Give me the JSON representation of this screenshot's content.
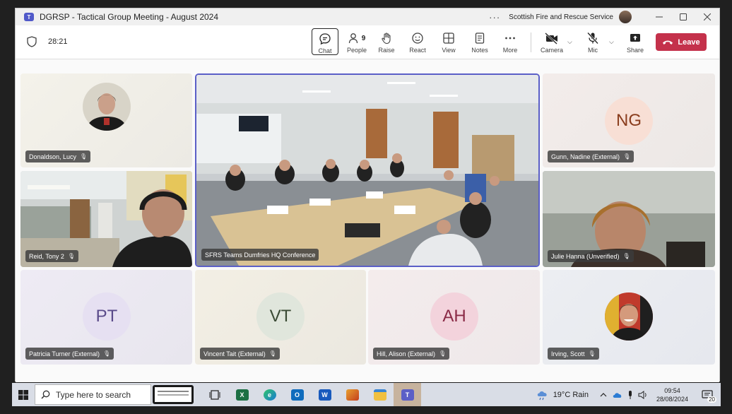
{
  "window": {
    "title": "DGRSP - Tactical Group Meeting - August 2024",
    "organization": "Scottish Fire and Rescue Service",
    "more_dots": "···"
  },
  "toolbar": {
    "timer": "28:21",
    "buttons": {
      "chat": "Chat",
      "people": "People",
      "people_count": "9",
      "raise": "Raise",
      "react": "React",
      "view": "View",
      "notes": "Notes",
      "more": "More",
      "camera": "Camera",
      "mic": "Mic",
      "share": "Share"
    },
    "leave": "Leave"
  },
  "participants": {
    "donaldson": {
      "name": "Donaldson, Lucy"
    },
    "reid": {
      "name": "Reid, Tony 2"
    },
    "conference": {
      "name": "SFRS Teams Dumfries HQ Conference"
    },
    "gunn": {
      "name": "Gunn, Nadine (External)",
      "initials": "NG"
    },
    "hanna": {
      "name": "Julie Hanna (Unverified)"
    },
    "turner": {
      "name": "Patricia Turner (External)",
      "initials": "PT"
    },
    "tait": {
      "name": "Vincent Tait (External)",
      "initials": "VT"
    },
    "hill": {
      "name": "Hill, Alison (External)",
      "initials": "AH"
    },
    "irving": {
      "name": "Irving, Scott"
    }
  },
  "colors": {
    "accent": "#5b5fc7",
    "leave": "#c4314b",
    "pt_bg": "#e6e0f2",
    "vt_bg": "#e0e6dc",
    "ah_bg": "#f3d3dc",
    "ng_bg": "#f8dfd5"
  },
  "taskbar": {
    "search_placeholder": "Type here to search",
    "weather": "19°C  Rain",
    "time": "09:54",
    "date": "28/08/2024",
    "notifications": "20",
    "apps": [
      "task-view",
      "excel",
      "edge",
      "outlook",
      "word",
      "powerpoint",
      "file-explorer",
      "teams"
    ]
  }
}
